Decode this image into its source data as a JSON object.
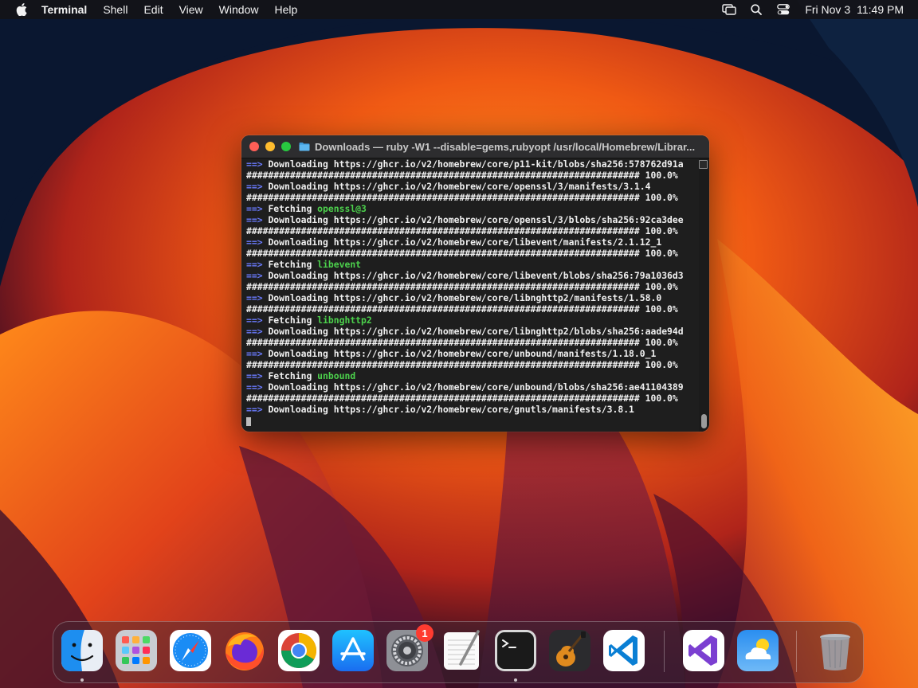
{
  "menubar": {
    "app_name": "Terminal",
    "menus": [
      "Shell",
      "Edit",
      "View",
      "Window",
      "Help"
    ],
    "date": "Fri Nov 3",
    "time": "11:49 PM",
    "status_icons": [
      "screen-mirroring-icon",
      "search-icon",
      "control-center-icon"
    ]
  },
  "terminal": {
    "title": "Downloads — ruby -W1 --disable=gems,rubyopt /usr/local/Homebrew/Librar...",
    "lines": [
      {
        "kind": "download",
        "arrow": "==>",
        "text": "Downloading https://ghcr.io/v2/homebrew/core/p11-kit/blobs/sha256:578762d91a"
      },
      {
        "kind": "progress",
        "text": "######################################################################## 100.0%"
      },
      {
        "kind": "download",
        "arrow": "==>",
        "text": "Downloading https://ghcr.io/v2/homebrew/core/openssl/3/manifests/3.1.4"
      },
      {
        "kind": "progress",
        "text": "######################################################################## 100.0%"
      },
      {
        "kind": "fetch",
        "arrow": "==>",
        "text": "Fetching",
        "pkg": "openssl@3"
      },
      {
        "kind": "download",
        "arrow": "==>",
        "text": "Downloading https://ghcr.io/v2/homebrew/core/openssl/3/blobs/sha256:92ca3dee"
      },
      {
        "kind": "progress",
        "text": "######################################################################## 100.0%"
      },
      {
        "kind": "download",
        "arrow": "==>",
        "text": "Downloading https://ghcr.io/v2/homebrew/core/libevent/manifests/2.1.12_1"
      },
      {
        "kind": "progress",
        "text": "######################################################################## 100.0%"
      },
      {
        "kind": "fetch",
        "arrow": "==>",
        "text": "Fetching",
        "pkg": "libevent"
      },
      {
        "kind": "download",
        "arrow": "==>",
        "text": "Downloading https://ghcr.io/v2/homebrew/core/libevent/blobs/sha256:79a1036d3"
      },
      {
        "kind": "progress",
        "text": "######################################################################## 100.0%"
      },
      {
        "kind": "download",
        "arrow": "==>",
        "text": "Downloading https://ghcr.io/v2/homebrew/core/libnghttp2/manifests/1.58.0"
      },
      {
        "kind": "progress",
        "text": "######################################################################## 100.0%"
      },
      {
        "kind": "fetch",
        "arrow": "==>",
        "text": "Fetching",
        "pkg": "libnghttp2"
      },
      {
        "kind": "download",
        "arrow": "==>",
        "text": "Downloading https://ghcr.io/v2/homebrew/core/libnghttp2/blobs/sha256:aade94d"
      },
      {
        "kind": "progress",
        "text": "######################################################################## 100.0%"
      },
      {
        "kind": "download",
        "arrow": "==>",
        "text": "Downloading https://ghcr.io/v2/homebrew/core/unbound/manifests/1.18.0_1"
      },
      {
        "kind": "progress",
        "text": "######################################################################## 100.0%"
      },
      {
        "kind": "fetch",
        "arrow": "==>",
        "text": "Fetching",
        "pkg": "unbound"
      },
      {
        "kind": "download",
        "arrow": "==>",
        "text": "Downloading https://ghcr.io/v2/homebrew/core/unbound/blobs/sha256:ae41104389"
      },
      {
        "kind": "progress",
        "text": "######################################################################## 100.0%"
      },
      {
        "kind": "download",
        "arrow": "==>",
        "text": "Downloading https://ghcr.io/v2/homebrew/core/gnutls/manifests/3.8.1"
      }
    ]
  },
  "dock": {
    "apps": [
      {
        "id": "finder",
        "icon": "finder-icon",
        "running": true
      },
      {
        "id": "launchpad",
        "icon": "launchpad-icon",
        "running": false
      },
      {
        "id": "safari",
        "icon": "safari-icon",
        "running": false
      },
      {
        "id": "firefox",
        "icon": "firefox-icon",
        "running": false
      },
      {
        "id": "chrome",
        "icon": "chrome-icon",
        "running": false
      },
      {
        "id": "app-store",
        "icon": "app-store-icon",
        "running": false
      },
      {
        "id": "system-settings",
        "icon": "system-settings-icon",
        "running": false,
        "badge": "1"
      },
      {
        "id": "textedit",
        "icon": "textedit-icon",
        "running": false
      },
      {
        "id": "terminal",
        "icon": "terminal-icon",
        "running": true
      },
      {
        "id": "garageband",
        "icon": "garageband-icon",
        "running": false
      },
      {
        "id": "vscode",
        "icon": "vscode-icon",
        "running": false
      },
      {
        "id": "visual-studio",
        "icon": "visual-studio-icon",
        "running": false
      },
      {
        "id": "weather",
        "icon": "weather-icon",
        "running": false
      },
      {
        "id": "trash",
        "icon": "trash-icon",
        "running": false
      }
    ]
  },
  "colors": {
    "arrow": "#6a7bff",
    "package": "#4cd14c",
    "terminal_bg": "#1e1e1e",
    "badge": "#ff3b30"
  }
}
